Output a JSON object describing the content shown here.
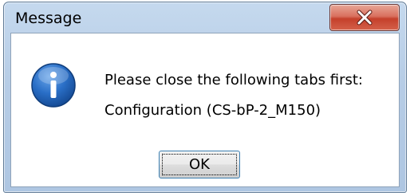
{
  "window": {
    "title": "Message"
  },
  "icons": {
    "info": "info-icon",
    "close": "close-icon"
  },
  "message": {
    "line1": "Please close the following tabs first:",
    "line2": "Configuration (CS-bP-2_M150)"
  },
  "buttons": {
    "ok_label": "OK"
  },
  "colors": {
    "info_blue": "#1e5fb4",
    "close_red": "#c5402b",
    "frame": "#b7cde6"
  }
}
